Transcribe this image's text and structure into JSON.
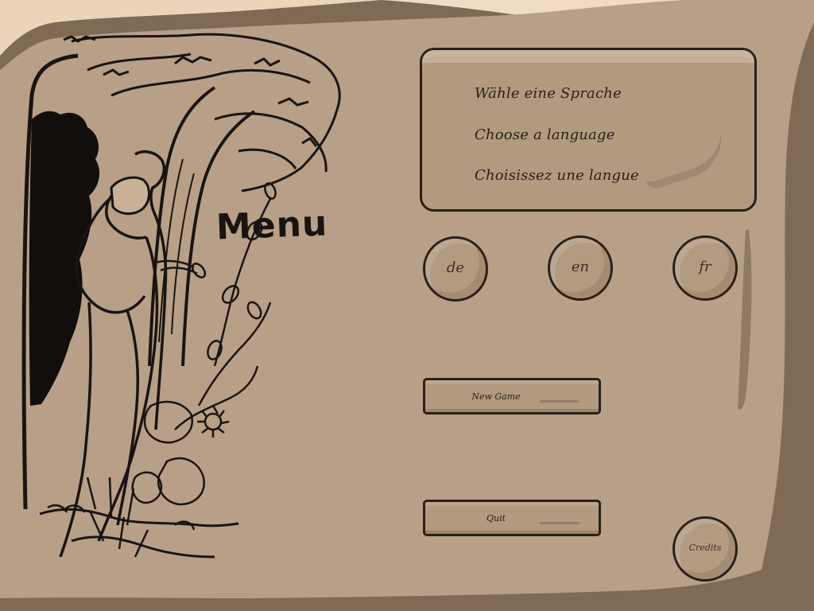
{
  "menu": {
    "title": "Menu"
  },
  "language_panel": {
    "lines": [
      "Wähle eine Sprache",
      "Choose a language",
      "Choisissez une langue"
    ]
  },
  "language_buttons": [
    {
      "label": "de"
    },
    {
      "label": "en"
    },
    {
      "label": "fr"
    }
  ],
  "buttons": {
    "new_game": "New Game",
    "quit": "Quit",
    "credits": "Credits"
  },
  "colors": {
    "parchment": "#b8a088",
    "parchment_light": "#ead5bb",
    "ink": "#1a1410",
    "shadow": "#7f6b55"
  },
  "icons": {
    "illustration": "couple-under-tree-illustration"
  }
}
